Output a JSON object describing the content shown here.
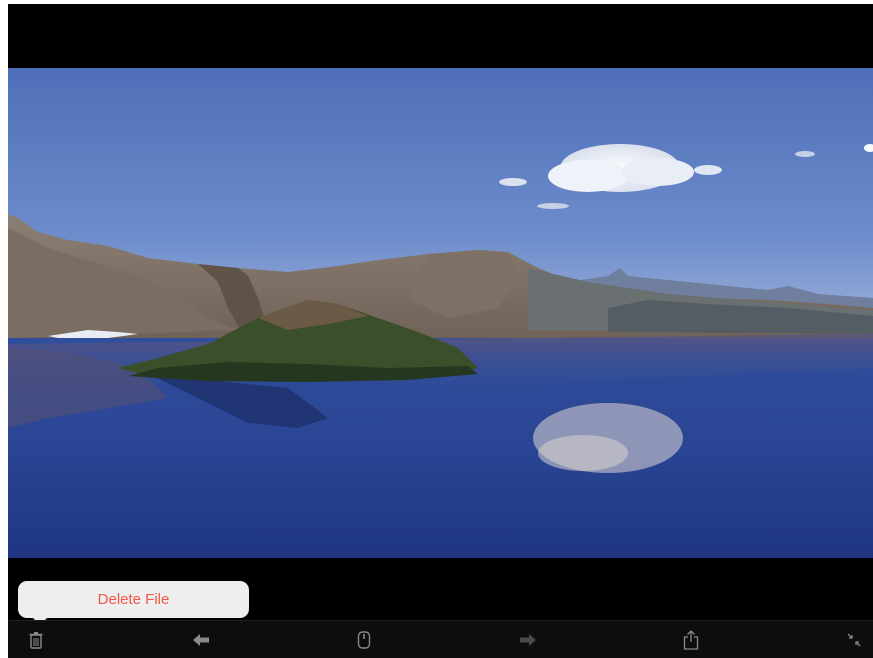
{
  "viewer": {
    "photo_name": "lake-landscape-photo"
  },
  "popover": {
    "delete_label": "Delete File",
    "label_color": "#f2574a"
  },
  "toolbar": {
    "buttons": [
      {
        "icon": "trash-icon"
      },
      {
        "icon": "arrow-left-icon"
      },
      {
        "icon": "mouse-icon"
      },
      {
        "icon": "arrow-right-icon"
      },
      {
        "icon": "share-icon"
      },
      {
        "icon": "collapse-icon"
      }
    ]
  }
}
